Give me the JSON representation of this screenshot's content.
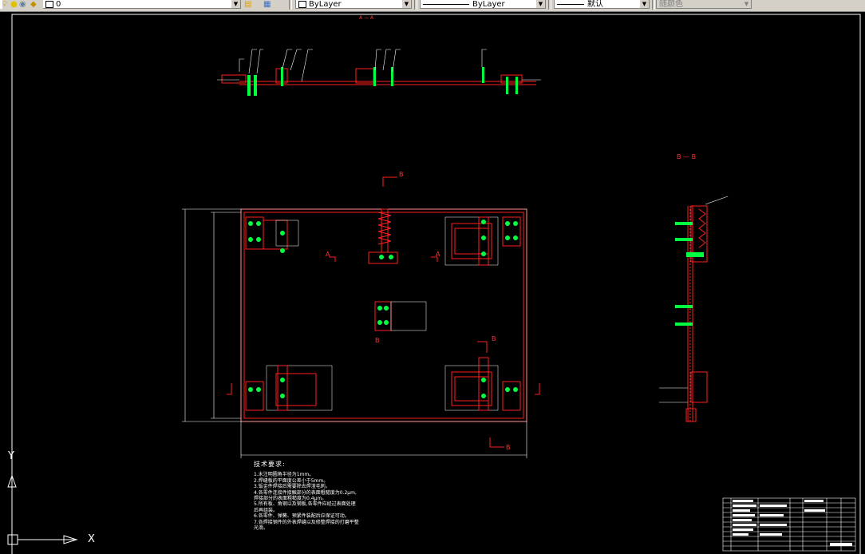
{
  "toolbar": {
    "layer_value": "0",
    "color_control": "ByLayer",
    "linetype_control": "ByLayer",
    "lineweight_control": "默认",
    "plotstyle_control": "随颜色"
  },
  "drawing": {
    "section_labels": {
      "top_mark": "A — A",
      "section_b_side": "B — B",
      "plan_b_top": "B",
      "plan_b_mid_left": "B",
      "plan_b_mid_right": "B",
      "plan_b_bottom": "B",
      "plan_a_left": "A",
      "plan_a_right": "A"
    },
    "tech_requirements": {
      "title": "技术要求:",
      "items": [
        "1.未注明圆角半径为1mm。",
        "2.焊缝板的平面度公差小于5mm。",
        "3.钣金件焊接后需要除去焊渣毛刺。",
        "4.各零件连接件接触部分的表面粗糙度为0.2μm,",
        "  焊接部分的表面粗糙度为0.4μm。",
        "5.所有板、角钢以及钢板,各零件应经过表面处理",
        "  后再组装。",
        "6.各零件、弹簧、预紧件装配后应保证可动。",
        "7.各焊接钢件的外表焊缝以及修整焊接的打磨平整",
        "  光滑。"
      ]
    },
    "ucs": {
      "y_label": "Y",
      "x_label": "X"
    },
    "colors": {
      "background": "#000000",
      "outline": "#ff2020",
      "hardware": "#00ff40",
      "dimension": "#ffffff"
    }
  }
}
